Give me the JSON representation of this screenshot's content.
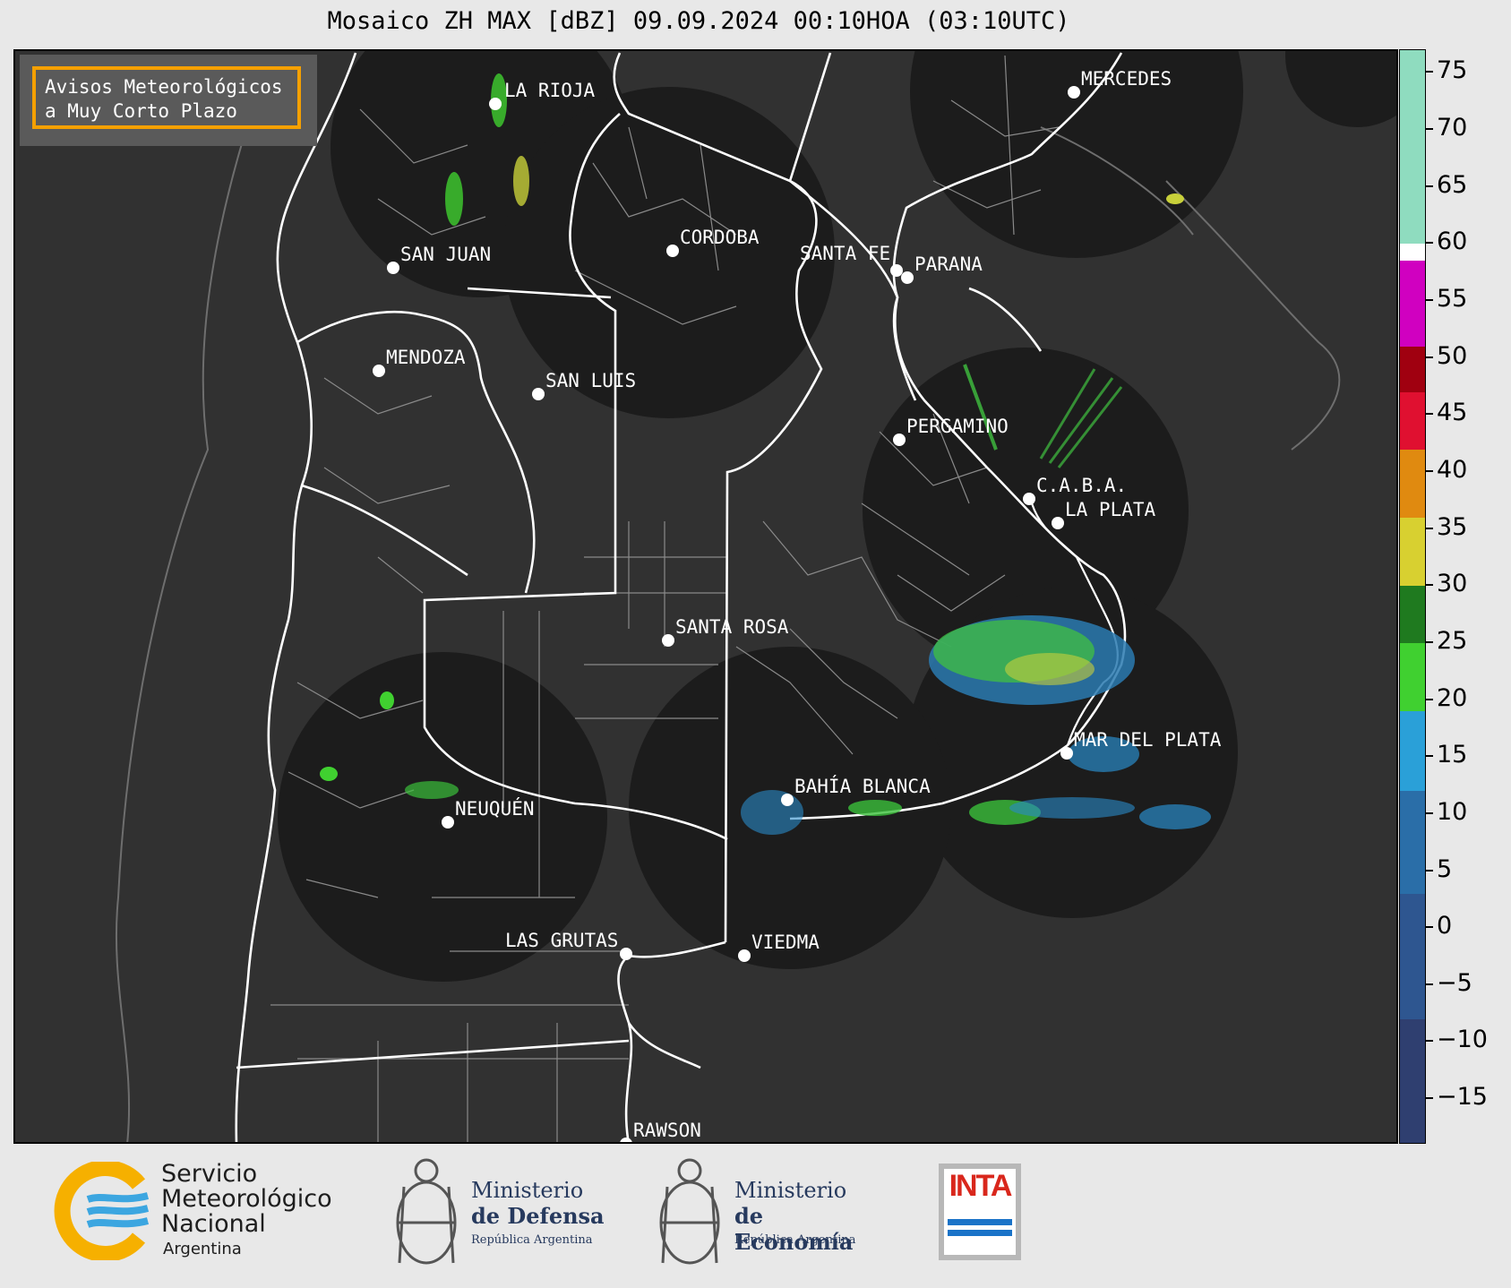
{
  "title": "Mosaico ZH MAX [dBZ] 09.09.2024 00:10HOA (03:10UTC)",
  "notice": {
    "line1": "Avisos Meteorológicos",
    "line2": "a Muy Corto Plazo"
  },
  "cities": [
    "LA RIOJA",
    "SAN JUAN",
    "CORDOBA",
    "SANTA FE",
    "PARANA",
    "MERCEDES",
    "MENDOZA",
    "SAN LUIS",
    "PERGAMINO",
    "C.A.B.A.",
    "LA PLATA",
    "SANTA ROSA",
    "MAR DEL PLATA",
    "BAHÍA BLANCA",
    "NEUQUÉN",
    "LAS GRUTAS",
    "VIEDMA",
    "RAWSON"
  ],
  "colorbar": {
    "unit": "dBZ",
    "min": -19,
    "max": 77,
    "ticks": [
      "75",
      "70",
      "65",
      "60",
      "55",
      "50",
      "45",
      "40",
      "35",
      "30",
      "25",
      "20",
      "15",
      "10",
      "5",
      "0",
      "−5",
      "−10",
      "−15"
    ],
    "tick_values": [
      75,
      70,
      65,
      60,
      55,
      50,
      45,
      40,
      35,
      30,
      25,
      20,
      15,
      10,
      5,
      0,
      -5,
      -10,
      -15
    ],
    "colors": [
      {
        "from": 60,
        "to": 77,
        "color": "#8fdcbf"
      },
      {
        "from": 58.5,
        "to": 60,
        "color": "#ffffff"
      },
      {
        "from": 51,
        "to": 58.5,
        "color": "#d000c0"
      },
      {
        "from": 47,
        "to": 51,
        "color": "#a00010"
      },
      {
        "from": 42,
        "to": 47,
        "color": "#e01030"
      },
      {
        "from": 36,
        "to": 42,
        "color": "#e08a10"
      },
      {
        "from": 30,
        "to": 36,
        "color": "#d8d030"
      },
      {
        "from": 25,
        "to": 30,
        "color": "#1f7a1f"
      },
      {
        "from": 19,
        "to": 25,
        "color": "#40d030"
      },
      {
        "from": 12,
        "to": 19,
        "color": "#2aa0d8"
      },
      {
        "from": 3,
        "to": 12,
        "color": "#2a6ea8"
      },
      {
        "from": -8,
        "to": 3,
        "color": "#2e5690"
      },
      {
        "from": -19,
        "to": -8,
        "color": "#2f3f70"
      }
    ]
  },
  "logos": {
    "smn": {
      "line1": "Servicio",
      "line2": "Meteorológico",
      "line3": "Nacional",
      "line4": "Argentina"
    },
    "defensa": {
      "line1": "Ministerio",
      "line2": "de Defensa",
      "line3": "República Argentina"
    },
    "economia": {
      "line1": "Ministerio",
      "line2": "de Economía",
      "line3": "República Argentina"
    },
    "inta": {
      "label": "INTA"
    }
  }
}
